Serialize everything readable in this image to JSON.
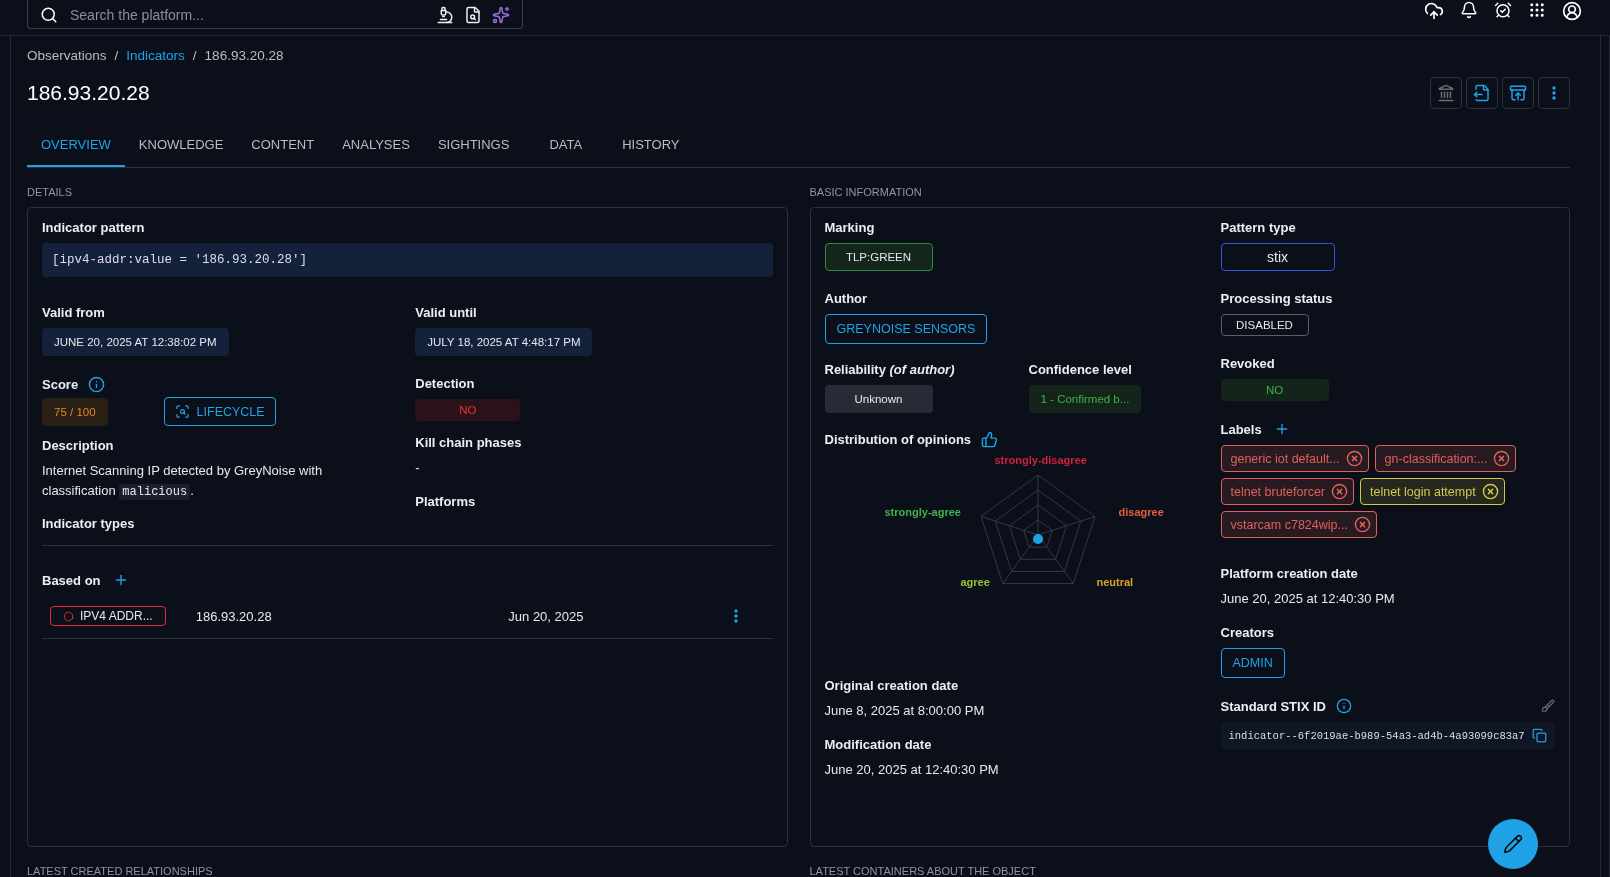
{
  "search": {
    "placeholder": "Search the platform..."
  },
  "breadcrumb": [
    {
      "label": "Observations",
      "link": false
    },
    {
      "label": "Indicators",
      "link": true
    },
    {
      "label": "186.93.20.28",
      "link": false
    }
  ],
  "breadcrumb_separator": "/",
  "title": "186.93.20.28",
  "tabs": [
    {
      "label": "OVERVIEW",
      "selected": true
    },
    {
      "label": "KNOWLEDGE",
      "selected": false
    },
    {
      "label": "CONTENT",
      "selected": false
    },
    {
      "label": "ANALYSES",
      "selected": false
    },
    {
      "label": "SIGHTINGS",
      "selected": false
    },
    {
      "label": "DATA",
      "selected": false
    },
    {
      "label": "HISTORY",
      "selected": false
    }
  ],
  "details": {
    "heading": "DETAILS",
    "pattern_label": "Indicator pattern",
    "pattern": "[ipv4-addr:value = '186.93.20.28']",
    "valid_from_label": "Valid from",
    "valid_from": "JUNE 20, 2025 AT 12:38:02 PM",
    "valid_until_label": "Valid until",
    "valid_until": "JULY 18, 2025 AT 4:48:17 PM",
    "score_label": "Score",
    "score": "75 / 100",
    "lifecycle_button": "LIFECYCLE",
    "detection_label": "Detection",
    "detection": "NO",
    "description_label": "Description",
    "description_text": "Internet Scanning IP detected by GreyNoise with classification",
    "description_code": "malicious",
    "description_end": ".",
    "kill_chain_label": "Kill chain phases",
    "kill_chain": "-",
    "platforms_label": "Platforms",
    "indicator_types_label": "Indicator types",
    "based_on_label": "Based on",
    "based_on": [
      {
        "type": "IPV4 ADDR...",
        "value": "186.93.20.28",
        "date": "Jun 20, 2025"
      }
    ]
  },
  "basic": {
    "heading": "BASIC INFORMATION",
    "marking_label": "Marking",
    "marking": "TLP:GREEN",
    "author_label": "Author",
    "author": "GREYNOISE SENSORS",
    "reliability_label": "Reliability *(of author)*",
    "reliability": "Unknown",
    "confidence_label": "Confidence level",
    "confidence": "1 - Confirmed b...",
    "opinions_label": "Distribution of opinions",
    "opinion_axes": [
      {
        "label": "strongly-disagree",
        "color": "#d0213f"
      },
      {
        "label": "disagree",
        "color": "#e0603a"
      },
      {
        "label": "neutral",
        "color": "#d9a12a"
      },
      {
        "label": "agree",
        "color": "#9bc23b"
      },
      {
        "label": "strongly-agree",
        "color": "#3fb24a"
      }
    ],
    "original_creation_label": "Original creation date",
    "original_creation": "June 8, 2025 at 8:00:00 PM",
    "modification_label": "Modification date",
    "modification": "June 20, 2025 at 12:40:30 PM",
    "pattern_type_label": "Pattern type",
    "pattern_type": "stix",
    "processing_label": "Processing status",
    "processing": "DISABLED",
    "revoked_label": "Revoked",
    "revoked": "NO",
    "labels_label": "Labels",
    "labels": [
      {
        "label": "generic iot default...",
        "color": "#e0605a"
      },
      {
        "label": "gn-classification:...",
        "color": "#e0605a"
      },
      {
        "label": "telnet bruteforcer",
        "color": "#e0605a"
      },
      {
        "label": "telnet login attempt",
        "color": "#d4c84a"
      },
      {
        "label": "vstarcam c7824wip...",
        "color": "#e0605a"
      }
    ],
    "platform_creation_label": "Platform creation date",
    "platform_creation": "June 20, 2025 at 12:40:30 PM",
    "creators_label": "Creators",
    "creators": [
      "ADMIN"
    ],
    "stix_label": "Standard STIX ID",
    "stix_id": "indicator--6f2019ae-b989-54a3-ad4b-4a93099c83a7"
  },
  "bottom_sections": [
    "LATEST CREATED RELATIONSHIPS",
    "LATEST CONTAINERS ABOUT THE OBJECT"
  ]
}
